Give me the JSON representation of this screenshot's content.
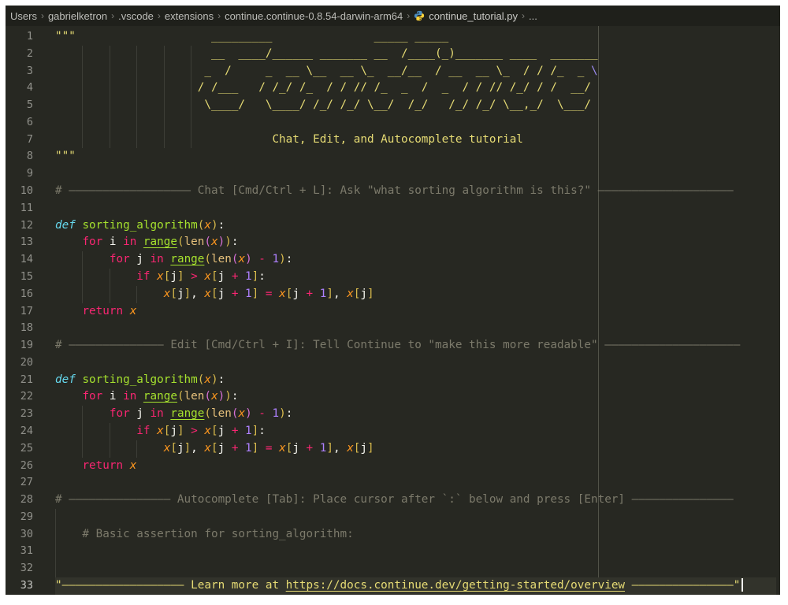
{
  "breadcrumb": {
    "separator": "›",
    "items": [
      "Users",
      "gabrielketron",
      ".vscode",
      "extensions",
      "continue.continue-0.8.54-darwin-arm64"
    ],
    "file_icon": "python-icon",
    "file": "continue_tutorial.py",
    "tail": "..."
  },
  "editor": {
    "language_hint": "Python",
    "current_line": 33,
    "caret": {
      "line": 33,
      "col": 101
    },
    "ruler_column": 80,
    "colors": {
      "background": "#272822",
      "breadcrumb_background": "#1f201b",
      "string": "#e6db74",
      "escape": "#9d8cf2",
      "comment": "#7c7a6b",
      "keyword": "#f92672",
      "storage_def": "#66d9ef",
      "function_name": "#a6e22e",
      "builtin_range": "#a6e22e",
      "builtin_len": "#e5c07b",
      "parameter": "#fd971f",
      "number": "#ae81ff",
      "bracket_depth1": "#d8ba4c",
      "bracket_depth2": "#d670d6",
      "plain": "#f8f8f2",
      "line_number": "#90908a",
      "current_line_background": "#32332b"
    },
    "lines": [
      {
        "n": 1,
        "guides": [],
        "segments": [
          [
            "str",
            "\"\"\"                    _________               _____ _____"
          ]
        ]
      },
      {
        "n": 2,
        "guides": [
          4,
          8,
          12,
          16,
          20
        ],
        "segments": [
          [
            "str",
            "                       __  ____/______ _______ __  /____(_)_______ ____  _______"
          ]
        ]
      },
      {
        "n": 3,
        "guides": [
          4,
          8,
          12,
          16,
          20
        ],
        "segments": [
          [
            "str",
            "                      _  /     _  __ \\__  __ \\_  __/__  / __  __ \\_  / / /_  _ "
          ],
          [
            "esc",
            "\\"
          ]
        ]
      },
      {
        "n": 4,
        "guides": [
          4,
          8,
          12,
          16,
          20
        ],
        "segments": [
          [
            "str",
            "                     / /___   / /_/ /_  / / // /_  _  /  _  / / // /_/ / /  __/"
          ]
        ]
      },
      {
        "n": 5,
        "guides": [
          4,
          8,
          12,
          16,
          20
        ],
        "segments": [
          [
            "str",
            "                      \\____/   \\____/ /_/ /_/ \\__/  /_/   /_/ /_/ \\__,_/  \\___/"
          ]
        ]
      },
      {
        "n": 6,
        "guides": [
          4,
          8,
          12,
          16,
          20
        ],
        "segments": []
      },
      {
        "n": 7,
        "guides": [
          4,
          8,
          12,
          16,
          20
        ],
        "segments": [
          [
            "str",
            "                                Chat, Edit, and Autocomplete tutorial"
          ]
        ]
      },
      {
        "n": 8,
        "guides": [],
        "segments": [
          [
            "str",
            "\"\"\""
          ]
        ]
      },
      {
        "n": 9,
        "guides": [],
        "segments": []
      },
      {
        "n": 10,
        "guides": [],
        "segments": [
          [
            "cm",
            "# —————————————————— Chat [Cmd/Ctrl + L]: Ask \"what sorting algorithm is this?\" ————————————————————"
          ]
        ]
      },
      {
        "n": 11,
        "guides": [],
        "segments": []
      },
      {
        "n": 12,
        "guides": [],
        "segments": [
          [
            "st",
            "def"
          ],
          [
            "pl",
            " "
          ],
          [
            "fn",
            "sorting_algorithm"
          ],
          [
            "b1",
            "("
          ],
          [
            "var",
            "x"
          ],
          [
            "b1",
            ")"
          ],
          [
            "pl",
            ":"
          ]
        ]
      },
      {
        "n": 13,
        "guides": [],
        "segments": [
          [
            "pl",
            "    "
          ],
          [
            "kw",
            "for"
          ],
          [
            "pl",
            " i "
          ],
          [
            "kw",
            "in"
          ],
          [
            "pl",
            " "
          ],
          [
            "bi",
            "range"
          ],
          [
            "b1",
            "("
          ],
          [
            "lenfn",
            "len"
          ],
          [
            "b2",
            "("
          ],
          [
            "var",
            "x"
          ],
          [
            "b2",
            ")"
          ],
          [
            "b1",
            ")"
          ],
          [
            "pl",
            ":"
          ]
        ]
      },
      {
        "n": 14,
        "guides": [
          4
        ],
        "segments": [
          [
            "pl",
            "        "
          ],
          [
            "kw",
            "for"
          ],
          [
            "pl",
            " j "
          ],
          [
            "kw",
            "in"
          ],
          [
            "pl",
            " "
          ],
          [
            "bi",
            "range"
          ],
          [
            "b1",
            "("
          ],
          [
            "lenfn",
            "len"
          ],
          [
            "b2",
            "("
          ],
          [
            "var",
            "x"
          ],
          [
            "b2",
            ")"
          ],
          [
            "pl",
            " "
          ],
          [
            "kw",
            "-"
          ],
          [
            "pl",
            " "
          ],
          [
            "num",
            "1"
          ],
          [
            "b1",
            ")"
          ],
          [
            "pl",
            ":"
          ]
        ]
      },
      {
        "n": 15,
        "guides": [
          4,
          8
        ],
        "segments": [
          [
            "pl",
            "            "
          ],
          [
            "kw",
            "if"
          ],
          [
            "pl",
            " "
          ],
          [
            "var",
            "x"
          ],
          [
            "b1",
            "["
          ],
          [
            "pl",
            "j"
          ],
          [
            "b1",
            "]"
          ],
          [
            "pl",
            " "
          ],
          [
            "kw",
            ">"
          ],
          [
            "pl",
            " "
          ],
          [
            "var",
            "x"
          ],
          [
            "b1",
            "["
          ],
          [
            "pl",
            "j "
          ],
          [
            "kw",
            "+"
          ],
          [
            "pl",
            " "
          ],
          [
            "num",
            "1"
          ],
          [
            "b1",
            "]"
          ],
          [
            "pl",
            ":"
          ]
        ]
      },
      {
        "n": 16,
        "guides": [
          4,
          8,
          12
        ],
        "segments": [
          [
            "pl",
            "                "
          ],
          [
            "var",
            "x"
          ],
          [
            "b1",
            "["
          ],
          [
            "pl",
            "j"
          ],
          [
            "b1",
            "]"
          ],
          [
            "pl",
            ", "
          ],
          [
            "var",
            "x"
          ],
          [
            "b1",
            "["
          ],
          [
            "pl",
            "j "
          ],
          [
            "kw",
            "+"
          ],
          [
            "pl",
            " "
          ],
          [
            "num",
            "1"
          ],
          [
            "b1",
            "]"
          ],
          [
            "pl",
            " "
          ],
          [
            "kw",
            "="
          ],
          [
            "pl",
            " "
          ],
          [
            "var",
            "x"
          ],
          [
            "b1",
            "["
          ],
          [
            "pl",
            "j "
          ],
          [
            "kw",
            "+"
          ],
          [
            "pl",
            " "
          ],
          [
            "num",
            "1"
          ],
          [
            "b1",
            "]"
          ],
          [
            "pl",
            ", "
          ],
          [
            "var",
            "x"
          ],
          [
            "b1",
            "["
          ],
          [
            "pl",
            "j"
          ],
          [
            "b1",
            "]"
          ]
        ]
      },
      {
        "n": 17,
        "guides": [],
        "segments": [
          [
            "pl",
            "    "
          ],
          [
            "kw",
            "return"
          ],
          [
            "pl",
            " "
          ],
          [
            "var",
            "x"
          ]
        ]
      },
      {
        "n": 18,
        "guides": [],
        "segments": []
      },
      {
        "n": 19,
        "guides": [],
        "segments": [
          [
            "cm",
            "# —————————————— Edit [Cmd/Ctrl + I]: Tell Continue to \"make this more readable\" ————————————————————"
          ]
        ]
      },
      {
        "n": 20,
        "guides": [],
        "segments": []
      },
      {
        "n": 21,
        "guides": [],
        "segments": [
          [
            "st",
            "def"
          ],
          [
            "pl",
            " "
          ],
          [
            "fn",
            "sorting_algorithm"
          ],
          [
            "b1",
            "("
          ],
          [
            "var",
            "x"
          ],
          [
            "b1",
            ")"
          ],
          [
            "pl",
            ":"
          ]
        ]
      },
      {
        "n": 22,
        "guides": [],
        "segments": [
          [
            "pl",
            "    "
          ],
          [
            "kw",
            "for"
          ],
          [
            "pl",
            " i "
          ],
          [
            "kw",
            "in"
          ],
          [
            "pl",
            " "
          ],
          [
            "bi",
            "range"
          ],
          [
            "b1",
            "("
          ],
          [
            "lenfn",
            "len"
          ],
          [
            "b2",
            "("
          ],
          [
            "var",
            "x"
          ],
          [
            "b2",
            ")"
          ],
          [
            "b1",
            ")"
          ],
          [
            "pl",
            ":"
          ]
        ]
      },
      {
        "n": 23,
        "guides": [
          4
        ],
        "segments": [
          [
            "pl",
            "        "
          ],
          [
            "kw",
            "for"
          ],
          [
            "pl",
            " j "
          ],
          [
            "kw",
            "in"
          ],
          [
            "pl",
            " "
          ],
          [
            "bi",
            "range"
          ],
          [
            "b1",
            "("
          ],
          [
            "lenfn",
            "len"
          ],
          [
            "b2",
            "("
          ],
          [
            "var",
            "x"
          ],
          [
            "b2",
            ")"
          ],
          [
            "pl",
            " "
          ],
          [
            "kw",
            "-"
          ],
          [
            "pl",
            " "
          ],
          [
            "num",
            "1"
          ],
          [
            "b1",
            ")"
          ],
          [
            "pl",
            ":"
          ]
        ]
      },
      {
        "n": 24,
        "guides": [
          4,
          8
        ],
        "segments": [
          [
            "pl",
            "            "
          ],
          [
            "kw",
            "if"
          ],
          [
            "pl",
            " "
          ],
          [
            "var",
            "x"
          ],
          [
            "b1",
            "["
          ],
          [
            "pl",
            "j"
          ],
          [
            "b1",
            "]"
          ],
          [
            "pl",
            " "
          ],
          [
            "kw",
            ">"
          ],
          [
            "pl",
            " "
          ],
          [
            "var",
            "x"
          ],
          [
            "b1",
            "["
          ],
          [
            "pl",
            "j "
          ],
          [
            "kw",
            "+"
          ],
          [
            "pl",
            " "
          ],
          [
            "num",
            "1"
          ],
          [
            "b1",
            "]"
          ],
          [
            "pl",
            ":"
          ]
        ]
      },
      {
        "n": 25,
        "guides": [
          4,
          8,
          12
        ],
        "segments": [
          [
            "pl",
            "                "
          ],
          [
            "var",
            "x"
          ],
          [
            "b1",
            "["
          ],
          [
            "pl",
            "j"
          ],
          [
            "b1",
            "]"
          ],
          [
            "pl",
            ", "
          ],
          [
            "var",
            "x"
          ],
          [
            "b1",
            "["
          ],
          [
            "pl",
            "j "
          ],
          [
            "kw",
            "+"
          ],
          [
            "pl",
            " "
          ],
          [
            "num",
            "1"
          ],
          [
            "b1",
            "]"
          ],
          [
            "pl",
            " "
          ],
          [
            "kw",
            "="
          ],
          [
            "pl",
            " "
          ],
          [
            "var",
            "x"
          ],
          [
            "b1",
            "["
          ],
          [
            "pl",
            "j "
          ],
          [
            "kw",
            "+"
          ],
          [
            "pl",
            " "
          ],
          [
            "num",
            "1"
          ],
          [
            "b1",
            "]"
          ],
          [
            "pl",
            ", "
          ],
          [
            "var",
            "x"
          ],
          [
            "b1",
            "["
          ],
          [
            "pl",
            "j"
          ],
          [
            "b1",
            "]"
          ]
        ]
      },
      {
        "n": 26,
        "guides": [],
        "segments": [
          [
            "pl",
            "    "
          ],
          [
            "kw",
            "return"
          ],
          [
            "pl",
            " "
          ],
          [
            "var",
            "x"
          ]
        ]
      },
      {
        "n": 27,
        "guides": [],
        "segments": []
      },
      {
        "n": 28,
        "guides": [],
        "segments": [
          [
            "cm",
            "# ——————————————— Autocomplete [Tab]: Place cursor after `:` below and press [Enter] ———————————————"
          ]
        ]
      },
      {
        "n": 29,
        "guides": [
          0
        ],
        "segments": []
      },
      {
        "n": 30,
        "guides": [
          0
        ],
        "segments": [
          [
            "cm",
            "    # Basic assertion for sorting_algorithm:"
          ]
        ]
      },
      {
        "n": 31,
        "guides": [
          0
        ],
        "segments": []
      },
      {
        "n": 32,
        "guides": [
          0
        ],
        "segments": []
      },
      {
        "n": 33,
        "guides": [],
        "segments": [
          [
            "str",
            "\"—————————————————— Learn more at "
          ],
          [
            "url",
            "https://docs.continue.dev/getting-started/overview"
          ],
          [
            "str",
            " ———————————————\""
          ]
        ]
      }
    ]
  }
}
